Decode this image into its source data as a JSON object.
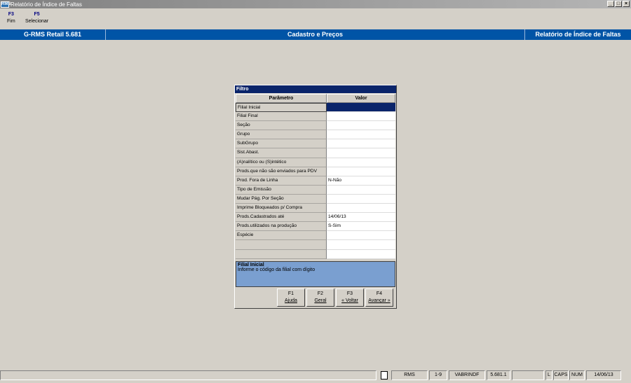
{
  "window": {
    "title": "Relatório de Índice de Faltas",
    "app_icon": "RMS",
    "controls": [
      "_",
      "□",
      "×"
    ]
  },
  "toolbar": {
    "keys": [
      {
        "key": "F3",
        "label": "Fim"
      },
      {
        "key": "F5",
        "label": "Selecionar"
      }
    ]
  },
  "header": {
    "left": "G-RMS Retail 5.681",
    "center": "Cadastro e Preços",
    "right": "Relatório de Índice de Faltas"
  },
  "dialog": {
    "title": "Filtro",
    "col_param": "Parâmetro",
    "col_value": "Valor",
    "rows": [
      {
        "param": "Filial Inicial",
        "value": ""
      },
      {
        "param": "Filial Final",
        "value": ""
      },
      {
        "param": "Seção",
        "value": ""
      },
      {
        "param": "Grupo",
        "value": ""
      },
      {
        "param": "SubGrupo",
        "value": ""
      },
      {
        "param": "Sist.Abast.",
        "value": ""
      },
      {
        "param": "(A)nalítico ou (S)intético",
        "value": ""
      },
      {
        "param": "Prods.que não são enviados para PDV",
        "value": ""
      },
      {
        "param": "Prod. Fora de Linha",
        "value": "N-Não"
      },
      {
        "param": "Tipo de Emissão",
        "value": ""
      },
      {
        "param": "Mudar Pág. Por Seção",
        "value": ""
      },
      {
        "param": "Imprime Bloqueados p/ Compra",
        "value": ""
      },
      {
        "param": "Prods.Cadastrados até",
        "value": "14/06/13"
      },
      {
        "param": "Prods.utilizados na produção",
        "value": "S-Sim"
      },
      {
        "param": "Espécie",
        "value": ""
      },
      {
        "param": "",
        "value": ""
      },
      {
        "param": "",
        "value": ""
      }
    ],
    "help_title": "Filial Inicial",
    "help_text": "Informe o código da filial com dígito",
    "buttons": [
      {
        "key": "F1",
        "label": "Ajuda"
      },
      {
        "key": "F2",
        "label": "Geral"
      },
      {
        "key": "F3",
        "label": "« Voltar"
      },
      {
        "key": "F4",
        "label": "Avançar »"
      }
    ]
  },
  "status": {
    "user": "RMS",
    "code": "1-9",
    "program": "VABRINDF",
    "version": "5.681.1",
    "blank": "",
    "l": "L",
    "caps": "CAPS",
    "num": "NUM",
    "date": "14/06/13"
  }
}
